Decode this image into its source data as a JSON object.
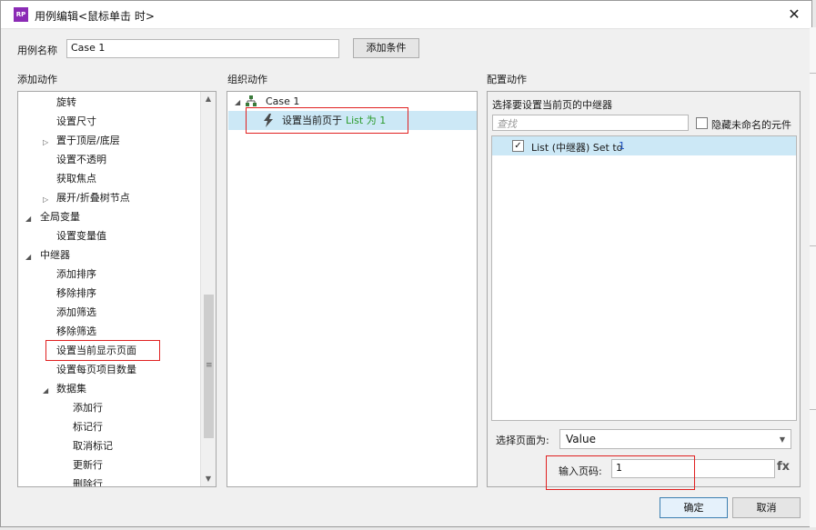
{
  "window": {
    "title": "用例编辑<鼠标单击 时>",
    "app_icon_text": "RP",
    "close_glyph": "✕"
  },
  "case_name": {
    "label": "用例名称",
    "value": "Case 1",
    "add_condition_label": "添加条件"
  },
  "add_actions": {
    "heading": "添加动作",
    "items": [
      {
        "label": "旋转"
      },
      {
        "label": "设置尺寸"
      },
      {
        "label": "置于顶层/底层"
      },
      {
        "label": "设置不透明"
      },
      {
        "label": "获取焦点"
      },
      {
        "label": "展开/折叠树节点"
      },
      {
        "label": "全局变量"
      },
      {
        "label": "设置变量值"
      },
      {
        "label": "中继器"
      },
      {
        "label": "添加排序"
      },
      {
        "label": "移除排序"
      },
      {
        "label": "添加筛选"
      },
      {
        "label": "移除筛选"
      },
      {
        "label": "设置当前显示页面"
      },
      {
        "label": "设置每页项目数量"
      },
      {
        "label": "数据集"
      },
      {
        "label": "添加行"
      },
      {
        "label": "标记行"
      },
      {
        "label": "取消标记"
      },
      {
        "label": "更新行"
      },
      {
        "label": "删除行"
      }
    ]
  },
  "organize_actions": {
    "heading": "组织动作",
    "case_label": "Case 1",
    "action_prefix": "设置当前页于",
    "action_target": "List 为 1"
  },
  "configure_actions": {
    "heading": "配置动作",
    "select_repeater_label": "选择要设置当前页的中继器",
    "search_placeholder": "查找",
    "hide_unnamed_label": "隐藏未命名的元件",
    "repeater_item_prefix": "List (中继器) Set to",
    "repeater_item_value": "1",
    "select_page_label": "选择页面为:",
    "select_page_value": "Value",
    "page_number_label": "输入页码:",
    "page_number_value": "1",
    "fx_label": "fx"
  },
  "footer": {
    "ok_label": "确定",
    "cancel_label": "取消"
  },
  "colors": {
    "selected_row": "#cce8f6",
    "highlight_box": "#e02020",
    "green_text": "#2a9a2a"
  }
}
